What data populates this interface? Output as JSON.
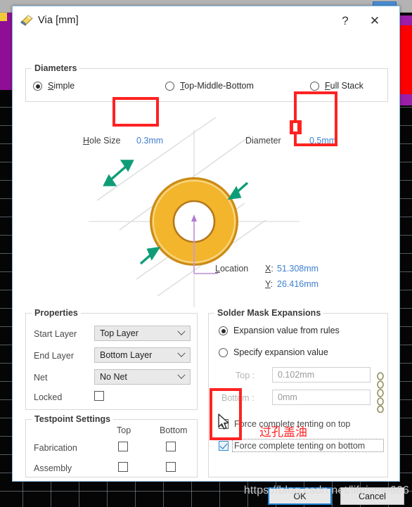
{
  "window": {
    "title": "Via [mm]",
    "icon": "via-tool-icon",
    "help_label": "?",
    "close_label": "✕"
  },
  "diameters": {
    "group_title": "Diameters",
    "modes": [
      {
        "label": "Simple",
        "mnemonic": "S",
        "selected": true
      },
      {
        "label": "Top-Middle-Bottom",
        "mnemonic": "T",
        "selected": false
      },
      {
        "label": "Full Stack",
        "mnemonic": "F",
        "selected": false
      }
    ],
    "hole_size_label": "Hole Size",
    "hole_size_value": "0.3mm",
    "diameter_label": "Diameter",
    "diameter_value": "0.5mm",
    "location_label": "Location",
    "location_x_label": "X:",
    "location_x_value": "51.308mm",
    "location_y_label": "Y:",
    "location_y_value": "26.416mm"
  },
  "properties": {
    "group_title": "Properties",
    "start_layer_label": "Start Layer",
    "start_layer_value": "Top Layer",
    "end_layer_label": "End Layer",
    "end_layer_value": "Bottom Layer",
    "net_label": "Net",
    "net_value": "No Net",
    "locked_label": "Locked",
    "locked_checked": false
  },
  "testpoint": {
    "group_title": "Testpoint Settings",
    "col_top": "Top",
    "col_bottom": "Bottom",
    "rows": [
      {
        "label": "Fabrication",
        "top_checked": false,
        "bottom_checked": false
      },
      {
        "label": "Assembly",
        "top_checked": false,
        "bottom_checked": false
      }
    ]
  },
  "solder_mask": {
    "group_title": "Solder Mask Expansions",
    "from_rules_label": "Expansion value from rules",
    "from_rules_selected": true,
    "specify_label": "Specify expansion value",
    "specify_selected": false,
    "top_label": "Top :",
    "top_value": "0.102mm",
    "bottom_label": "Bottom :",
    "bottom_value": "0mm",
    "link_icon": "chain-link-icon",
    "tenting_top_label": "Force complete tenting on top",
    "tenting_top_checked": true,
    "tenting_bottom_label": "Force complete tenting on bottom",
    "tenting_bottom_checked": true
  },
  "footer": {
    "ok_label": "OK",
    "cancel_label": "Cancel"
  },
  "annotations": {
    "note_cn": "过孔盖油",
    "highlight_color": "#fe2222"
  },
  "watermark": {
    "text": "https://blog.csdn.net/lifeisme666"
  },
  "colors": {
    "accent_blue": "#3f7fd0",
    "via_gold": "#f0b32a",
    "arrow_teal": "#0f9d78",
    "annotation_red": "#fe2222"
  }
}
